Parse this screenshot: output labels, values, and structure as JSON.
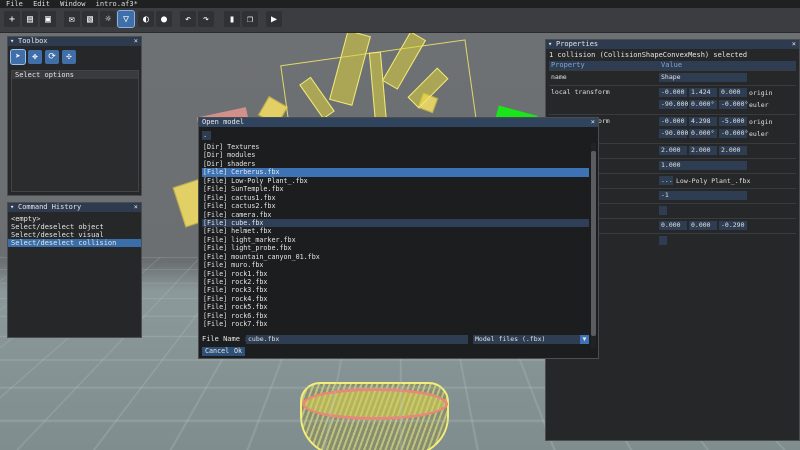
{
  "menu": [
    "File",
    "Edit",
    "Window",
    "intro.af3*"
  ],
  "toolbar_icons": [
    "new-file-icon",
    "open-file-icon",
    "save-icon",
    "envelope-icon",
    "image-icon",
    "sun-icon",
    "filter-icon",
    "target-icon",
    "sphere-icon",
    "undo-icon",
    "redo-icon",
    "trash-icon",
    "copy-icon",
    "play-icon"
  ],
  "toolbox": {
    "title": "Toolbox",
    "tools": [
      "select-arrow-icon",
      "move-icon",
      "rotate-icon",
      "scale-icon"
    ],
    "select_options_label": "Select options"
  },
  "history": {
    "title": "Command History",
    "items": [
      "<empty>",
      "Select/deselect object",
      "Select/deselect visual",
      "Select/deselect collision"
    ],
    "selected_index": 3
  },
  "properties": {
    "title": "Properties",
    "subtitle": "1 collision (CollisionShapeConvexMesh) selected",
    "col_property": "Property",
    "col_value": "Value",
    "name_label": "name",
    "name_value": "Shape",
    "local_label": "local transform",
    "local_origin": [
      "-0.000",
      "1.424",
      "0.000"
    ],
    "local_origin_label": "origin",
    "local_euler": [
      "-90.000",
      "0.000°",
      "-0.000°"
    ],
    "local_euler_label": "euler",
    "world_label": "world transform",
    "world_origin": [
      "-0.000",
      "4.298",
      "-5.000"
    ],
    "world_origin_label": "origin",
    "world_euler": [
      "-90.000",
      "0.000°",
      "-0.000°"
    ],
    "world_euler_label": "euler",
    "scale_values": [
      "2.000",
      "2.000",
      "2.000"
    ],
    "single_value": "1.000",
    "mesh_button": "...",
    "mesh_value": "Low-Poly Plant_.fbx",
    "int_value": "-1",
    "offset_values": [
      "0.000",
      "0.000",
      "-0.290"
    ]
  },
  "dialog": {
    "title": "Open model",
    "path": ".",
    "files": [
      "[Dir]  Textures",
      "[Dir]  modules",
      "[Dir]  shaders",
      "[File] Cerberus.fbx",
      "[File] Low-Poly Plant_.fbx",
      "[File] SunTemple.fbx",
      "[File] cactus1.fbx",
      "[File] cactus2.fbx",
      "[File] camera.fbx",
      "[File] cube.fbx",
      "[File] helmet.fbx",
      "[File] light_marker.fbx",
      "[File] light_probe.fbx",
      "[File] mountain_canyon_01.fbx",
      "[File] muro.fbx",
      "[File] rock1.fbx",
      "[File] rock2.fbx",
      "[File] rock3.fbx",
      "[File] rock4.fbx",
      "[File] rock5.fbx",
      "[File] rock6.fbx",
      "[File] rock7.fbx"
    ],
    "selected_index": 3,
    "highlighted_index": 9,
    "filename_label": "File Name :",
    "filename_value": "cube.fbx",
    "filter_value": "Model files (.fbx)",
    "cancel": "Cancel",
    "ok": "Ok"
  },
  "colors": {
    "accent": "#3d73b4",
    "panel_bg": "#262729",
    "title_bg": "#2e3b4f"
  }
}
